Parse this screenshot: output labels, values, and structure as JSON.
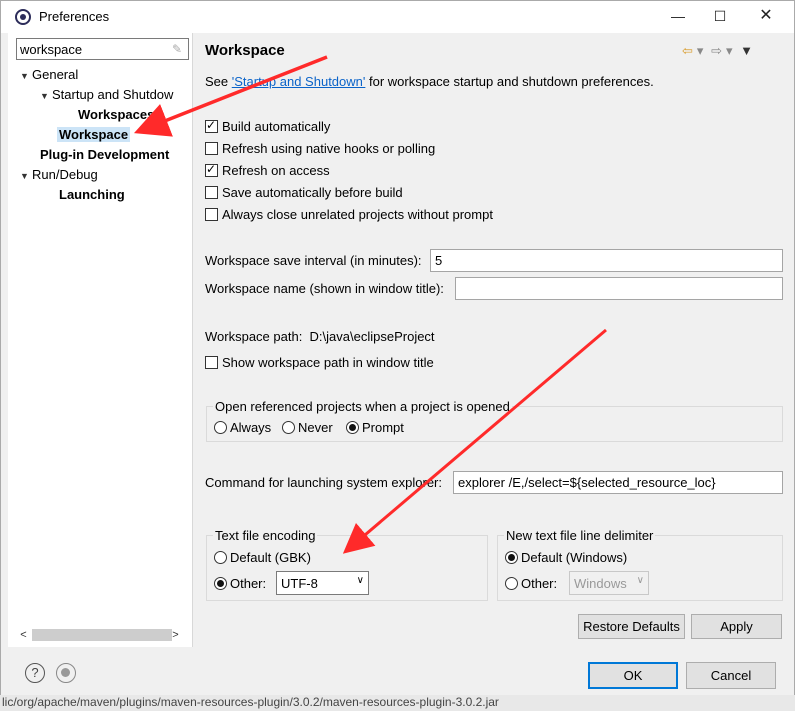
{
  "window": {
    "title": "Preferences",
    "minimize_glyph": "—",
    "maximize_glyph": "☐",
    "close_glyph": "✕"
  },
  "sidebar": {
    "filter_value": "workspace",
    "tree": [
      {
        "label": "General",
        "expanded": true
      },
      {
        "label": "Startup and Shutdow",
        "expanded": true
      },
      {
        "label": "Workspaces"
      },
      {
        "label": "Workspace",
        "selected": true
      },
      {
        "label": "Plug-in Development"
      },
      {
        "label": "Run/Debug",
        "expanded": true
      },
      {
        "label": "Launching"
      }
    ]
  },
  "main": {
    "title": "Workspace",
    "see_prefix": "See ",
    "see_link": "'Startup and Shutdown'",
    "see_suffix": " for workspace startup and shutdown preferences.",
    "checkboxes": [
      {
        "label": "Build automatically",
        "checked": true
      },
      {
        "label": "Refresh using native hooks or polling",
        "checked": false
      },
      {
        "label": "Refresh on access",
        "checked": true
      },
      {
        "label": "Save automatically before build",
        "checked": false
      },
      {
        "label": "Always close unrelated projects without prompt",
        "checked": false
      }
    ],
    "save_interval_label": "Workspace save interval (in minutes):",
    "save_interval_value": "5",
    "workspace_name_label": "Workspace name (shown in window title):",
    "workspace_name_value": "",
    "workspace_path_label": "Workspace path:",
    "workspace_path_value": "D:\\java\\eclipseProject",
    "show_path_label": "Show workspace path in window title",
    "show_path_checked": false,
    "open_ref_group": {
      "title": "Open referenced projects when a project is opened",
      "options": [
        "Always",
        "Never",
        "Prompt"
      ],
      "selected": "Prompt"
    },
    "explorer_label": "Command for launching system explorer:",
    "explorer_value": "explorer /E,/select=${selected_resource_loc}",
    "encoding_group": {
      "title": "Text file encoding",
      "default_label": "Default (GBK)",
      "other_label": "Other:",
      "selected": "Other",
      "other_value": "UTF-8"
    },
    "line_delim_group": {
      "title": "New text file line delimiter",
      "default_label": "Default (Windows)",
      "other_label": "Other:",
      "selected": "Default",
      "other_value": "Windows"
    },
    "restore_defaults_label": "Restore Defaults",
    "apply_label": "Apply"
  },
  "footer": {
    "ok_label": "OK",
    "cancel_label": "Cancel",
    "status_text": "lic/org/apache/maven/plugins/maven-resources-plugin/3.0.2/maven-resources-plugin-3.0.2.jar"
  },
  "colors": {
    "annotation_arrow": "#ff2a2a",
    "selection": "#cce4f7",
    "link": "#0a63c9"
  }
}
